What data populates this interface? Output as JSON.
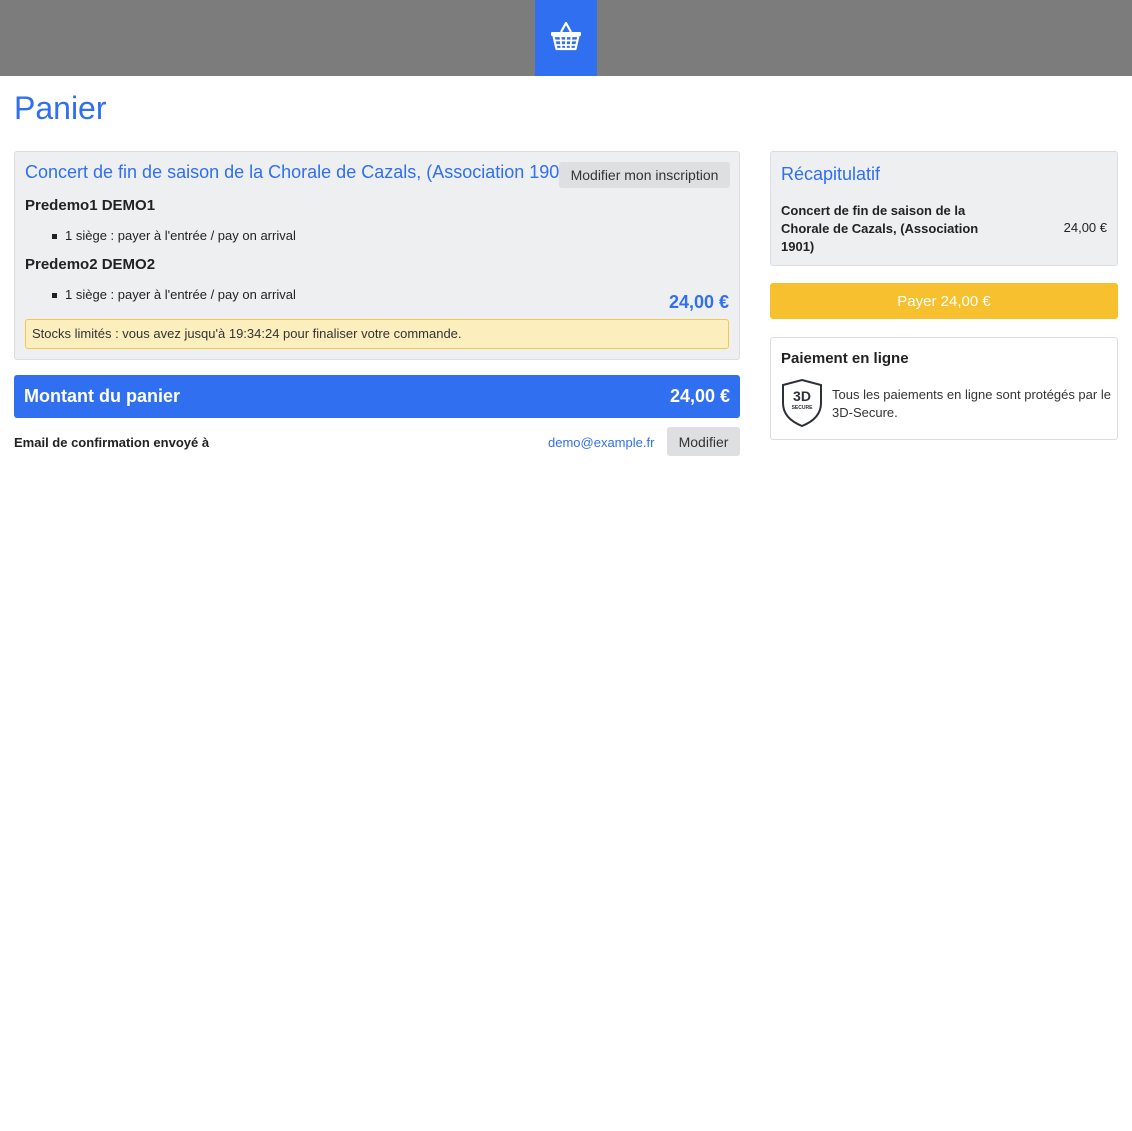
{
  "header": {
    "cart_icon": "shopping-basket-icon",
    "accent": "#2f6ff0",
    "bar_color": "#7c7c7c"
  },
  "page": {
    "title": "Panier"
  },
  "cart": {
    "event_title": "Concert de fin de saison de la Chorale de Cazals, (Association 1901)",
    "modify_registration_label": "Modifier mon inscription",
    "attendees": [
      {
        "name": "Predemo1 DEMO1",
        "seat": "1 siège : payer à l'entrée / pay on arrival"
      },
      {
        "name": "Predemo2 DEMO2",
        "seat": "1 siège : payer à l'entrée / pay on arrival"
      }
    ],
    "total": "24,00 €",
    "stock_warning": "Stocks limités : vous avez jusqu'à 19:34:24 pour finaliser votre commande."
  },
  "basket_total": {
    "label": "Montant du panier",
    "amount": "24,00 €"
  },
  "email": {
    "label": "Email de confirmation envoyé à",
    "value": "demo@example.fr",
    "modify_label": "Modifier"
  },
  "summary": {
    "title": "Récapitulatif",
    "item_label": "Concert de fin de saison de la Chorale de Cazals, (Association 1901)",
    "item_price": "24,00 €"
  },
  "pay_button": {
    "label": "Payer 24,00 €",
    "color": "#f6c02e"
  },
  "online_payment": {
    "title": "Paiement en ligne",
    "badge_big": "3D",
    "badge_small": "SECURE",
    "text": "Tous les paiements en ligne sont protégés par le 3D-Secure."
  }
}
